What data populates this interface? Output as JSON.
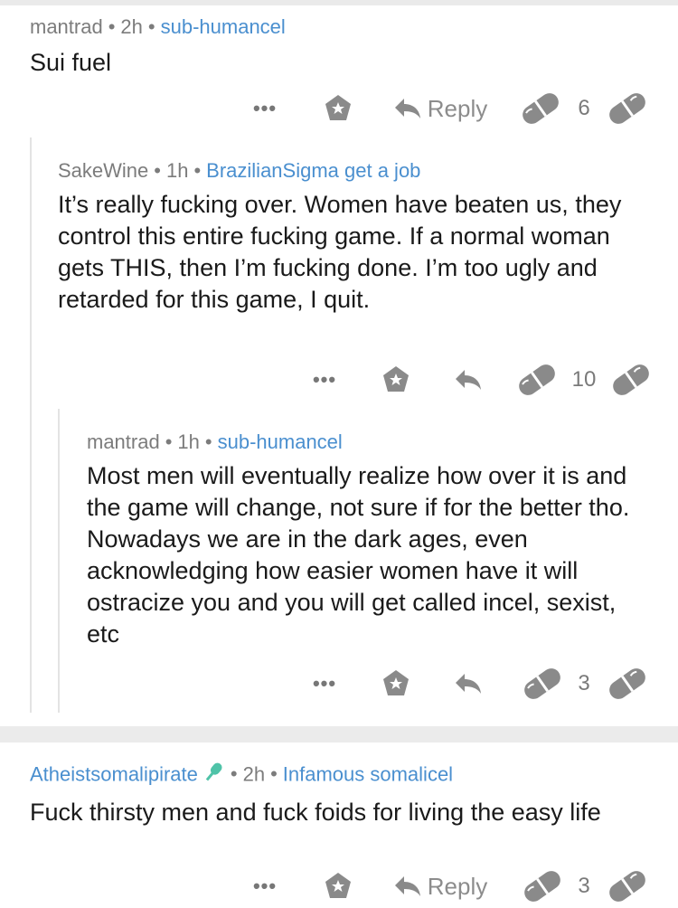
{
  "comments": [
    {
      "author": "mantrad",
      "age": "2h",
      "flair": "sub-humancel",
      "body": "Sui fuel",
      "more": "•••",
      "reply_label": "Reply",
      "score": "6"
    },
    {
      "author": "SakeWine",
      "age": "1h",
      "flair": "BrazilianSigma get a job",
      "body": "It’s really fucking over. Women have beaten us, they control this entire fucking game. If a normal woman gets THIS, then I’m fucking done. I’m too ugly and retarded for this game, I quit.",
      "more": "•••",
      "score": "10"
    },
    {
      "author": "mantrad",
      "age": "1h",
      "flair": "sub-humancel",
      "body": "Most men will eventually realize how over it is and the game will change, not sure if for the better tho. Nowadays we are in the dark ages, even acknowledging how easier women have it will ostracize you and you will get called incel, sexist, etc",
      "more": "•••",
      "score": "3"
    },
    {
      "author": "Atheistsomalipirate",
      "age": "2h",
      "flair": "Infamous somalicel",
      "body": "Fuck thirsty men and fuck foids for living the easy life",
      "more": "•••",
      "reply_label": "Reply",
      "score": "3"
    }
  ],
  "separator_dot": "•",
  "colors": {
    "flair": "#4a8fcf",
    "author_highlight": "#4a8fcf",
    "icon": "#8a8a8a",
    "line": "#e3e3e3"
  }
}
